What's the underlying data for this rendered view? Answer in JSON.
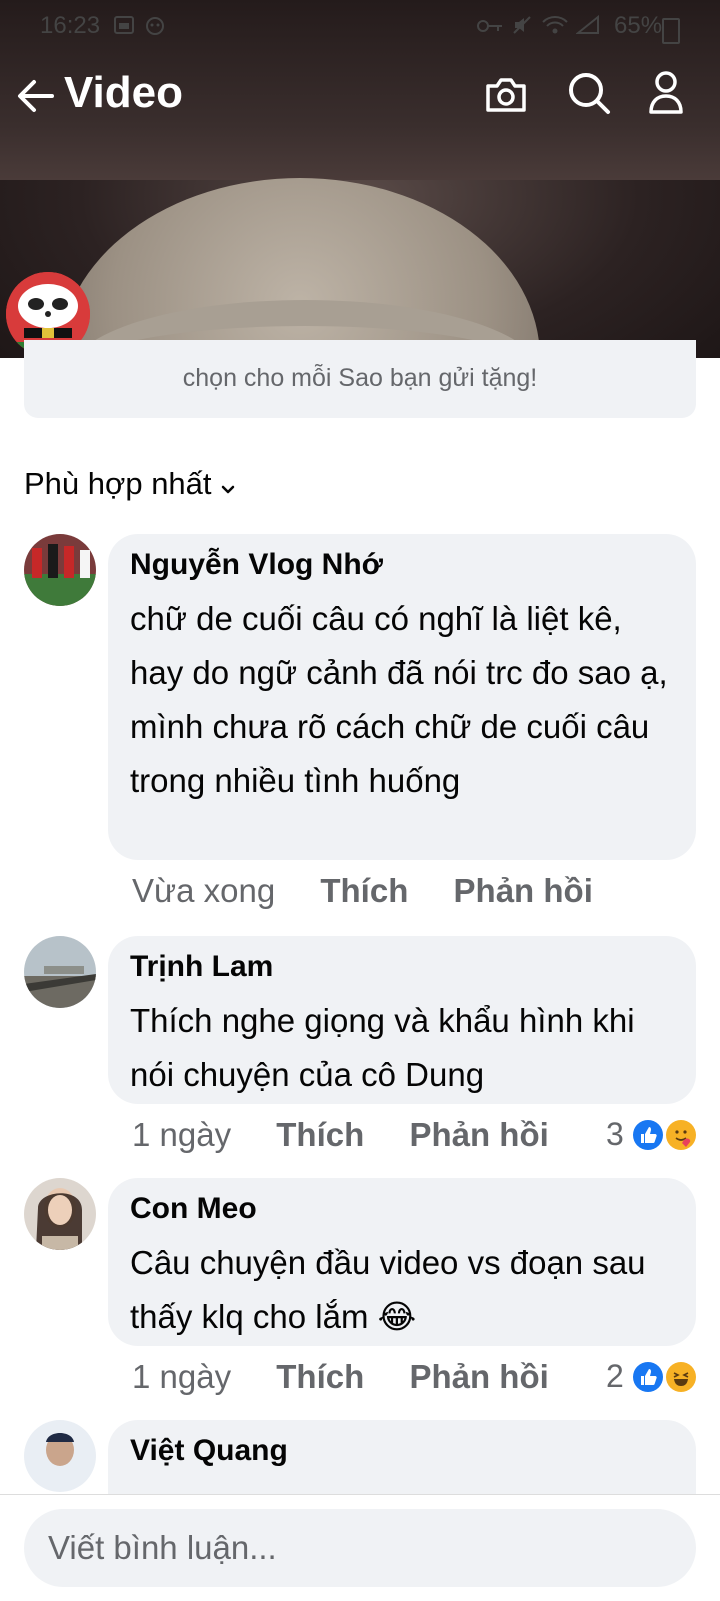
{
  "status_bar": {
    "time": "16:23",
    "battery": "65%"
  },
  "header": {
    "title": "Video"
  },
  "info_card": {
    "text": "chọn cho mỗi Sao bạn gửi tặng!"
  },
  "sort": {
    "label": "Phù hợp nhất"
  },
  "comments": [
    {
      "name": "Nguyễn Vlog Nhớ",
      "text": "chữ de cuối câu có nghĩ là liệt kê, hay do ngữ cảnh đã nói trc đo sao ạ, mình chưa rõ cách chữ de cuối câu trong nhiều tình huống",
      "time": "Vừa xong",
      "like": "Thích",
      "reply": "Phản hồi",
      "reaction_count": ""
    },
    {
      "name": "Trịnh Lam",
      "text": "Thích nghe giọng và khẩu hình khi nói chuyện của cô Dung",
      "time": "1 ngày",
      "like": "Thích",
      "reply": "Phản hồi",
      "reaction_count": "3",
      "reactions": [
        "like-icon",
        "care-icon"
      ]
    },
    {
      "name": "Con Meo",
      "text": "Câu chuyện đầu video vs đoạn sau thấy klq cho lắm 😂",
      "time": "1 ngày",
      "like": "Thích",
      "reply": "Phản hồi",
      "reaction_count": "2",
      "reactions": [
        "like-icon",
        "haha-icon"
      ]
    },
    {
      "name": "Việt Quang"
    }
  ],
  "input": {
    "placeholder": "Viết bình luận..."
  },
  "colors": {
    "bubble": "#f0f2f5",
    "meta_text": "#65676b",
    "like_blue": "#1877f2",
    "reaction_yellow": "#f7b125"
  }
}
